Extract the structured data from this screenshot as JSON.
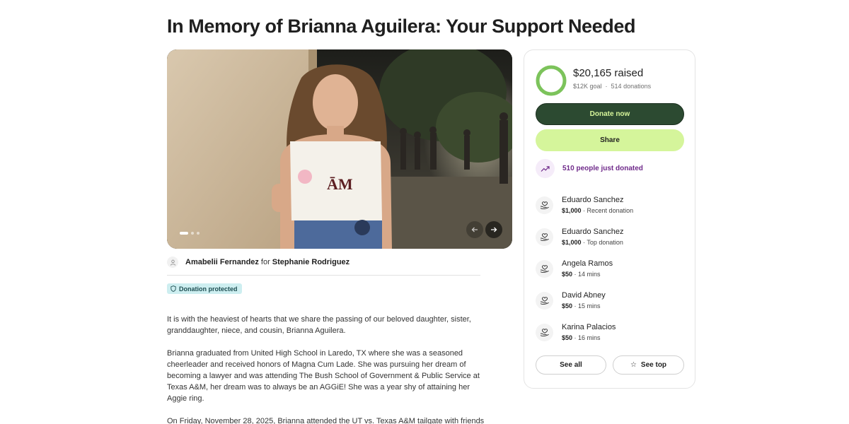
{
  "page": {
    "title": "In Memory of Brianna Aguilera: Your Support Needed"
  },
  "hero": {
    "image_description": "Photo of a young woman smiling and giving a thumbs up, wearing a white Texas A&M top at night",
    "slide_count": 3,
    "active_slide": 1,
    "prev_icon": "arrow-left-icon",
    "next_icon": "arrow-right-icon"
  },
  "organizer": {
    "icon": "person-icon",
    "name": "Amabelii Fernandez",
    "for_label": "for",
    "beneficiary": "Stephanie Rodriguez"
  },
  "badge": {
    "icon": "shield-icon",
    "label": "Donation protected"
  },
  "story": {
    "paragraphs": [
      "It is with the heaviest of hearts that we share the passing of our beloved daughter, sister, granddaughter, niece, and cousin, Brianna Aguilera.",
      "Brianna graduated from United High School in Laredo, TX where she was a seasoned cheerleader and received honors of Magna Cum Lade. She was pursuing her dream of becoming a lawyer and was attending The Bush School of Government & Public Service at Texas A&M, her dream was to always be an AGGiE! She was a year shy of attaining her Aggie ring.",
      "On Friday, November 28, 2025, Brianna attended the UT vs. Texas A&M tailgate with friends"
    ]
  },
  "summary": {
    "raised": "$20,165 raised",
    "goal": "$12K goal",
    "separator": "·",
    "donations": "514 donations",
    "progress_fraction": 1.0,
    "colors": {
      "progress": "#7cc35b",
      "track": "#e6f4dd"
    }
  },
  "actions": {
    "donate_label": "Donate now",
    "share_label": "Share",
    "see_all_label": "See all",
    "see_top_label": "See top",
    "see_top_icon": "star-icon"
  },
  "trend": {
    "icon": "trending-up-icon",
    "label": "510 people just donated"
  },
  "donations": [
    {
      "icon": "heart-hand-icon",
      "name": "Eduardo Sanchez",
      "amount": "$1,000",
      "detail": "· Recent donation"
    },
    {
      "icon": "heart-hand-icon",
      "name": "Eduardo Sanchez",
      "amount": "$1,000",
      "detail": "· Top donation"
    },
    {
      "icon": "heart-hand-icon",
      "name": "Angela Ramos",
      "amount": "$50",
      "detail": "· 14 mins"
    },
    {
      "icon": "heart-hand-icon",
      "name": "David Abney",
      "amount": "$50",
      "detail": "· 15 mins"
    },
    {
      "icon": "heart-hand-icon",
      "name": "Karina Palacios",
      "amount": "$50",
      "detail": "· 16 mins"
    }
  ],
  "colors": {
    "donate_bg": "#2c4a31",
    "donate_text": "#d6f59a",
    "share_bg": "#d5f59b",
    "trend_text": "#6f2a8a",
    "badge_bg": "#cdeef0"
  }
}
